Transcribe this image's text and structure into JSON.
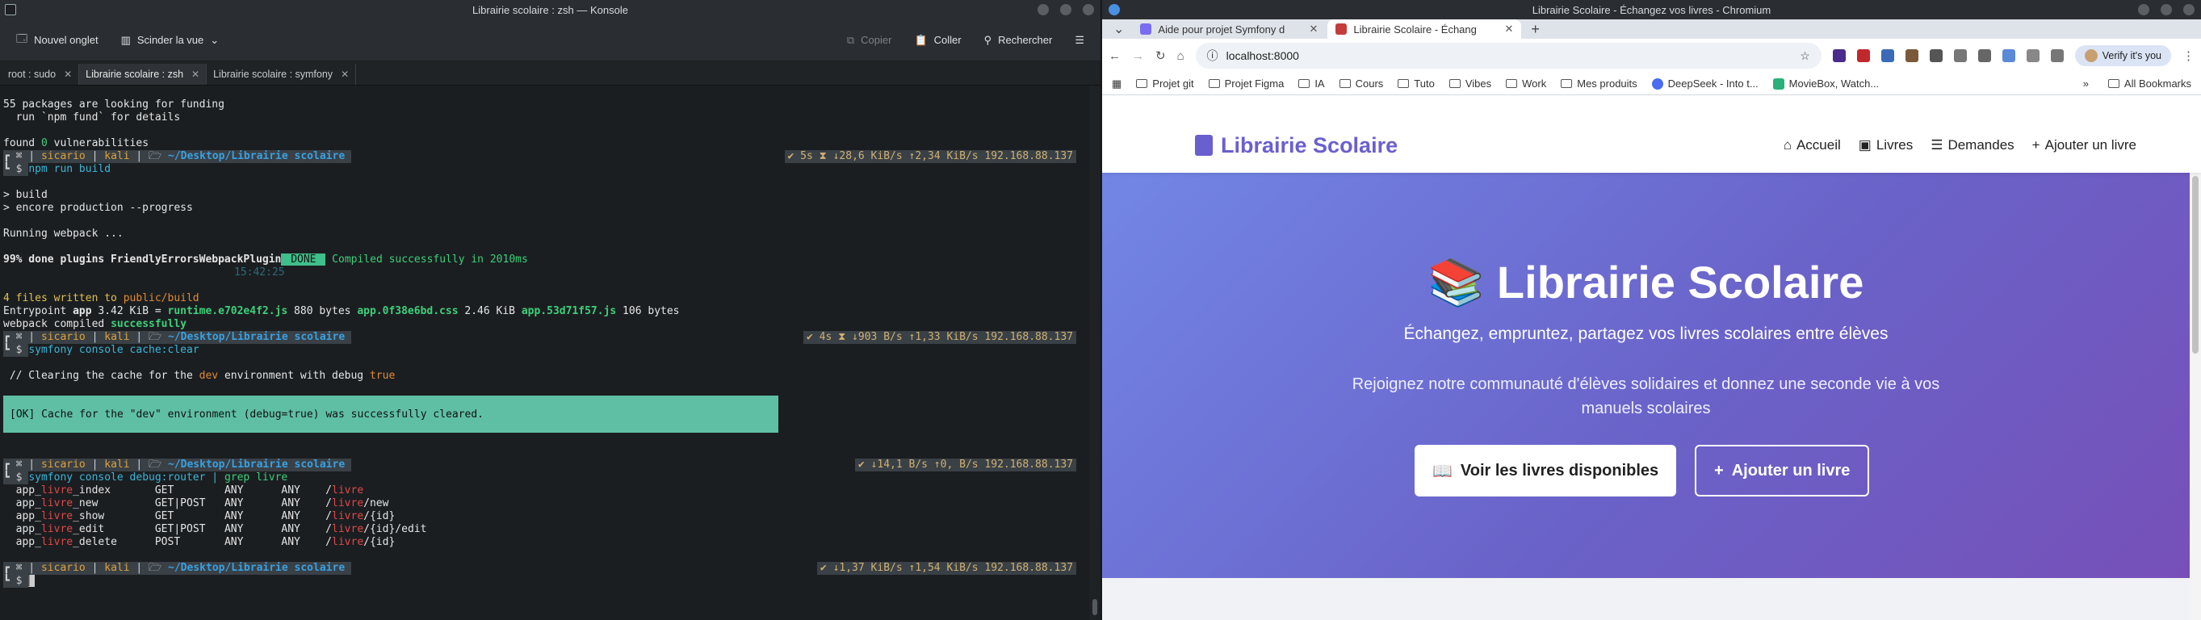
{
  "konsole": {
    "title": "Librairie scolaire : zsh — Konsole",
    "toolbar": {
      "new_tab": "Nouvel onglet",
      "split": "Scinder la vue",
      "copy": "Copier",
      "paste": "Coller",
      "search": "Rechercher"
    },
    "tabs": [
      {
        "label": "root : sudo"
      },
      {
        "label": "Librairie scolaire : zsh"
      },
      {
        "label": "Librairie scolaire : symfony"
      }
    ],
    "lines": {
      "l1": "55 packages are looking for funding",
      "l2": "  run `npm fund` for details",
      "l3a": "found ",
      "l3b": "0",
      "l3c": " vulnerabilities",
      "p_user": "sicario",
      "p_host": "kali",
      "p_path": "~/Desktop/Librairie scolaire",
      "s1": "✔ 5s ⧗ ↓28,6 KiB/s ↑2,34 KiB/s 192.168.88.137",
      "c1": "npm run build",
      "l4": "> build",
      "l5": "> encore production --progress",
      "l6": "Running webpack ...",
      "l7a": "99% done plugins FriendlyErrorsWebpackPlugin",
      "l7b": " DONE ",
      "l7c": " Compiled successfully in 2010ms",
      "l8": "15:42:25",
      "l9a": "4 files written to ",
      "l9b": "public/build",
      "l10a": "Entrypoint ",
      "l10b": "app",
      "l10c": " 3.42 KiB = ",
      "l10d": "runtime.e702e4f2.js",
      "l10e": " 880 bytes ",
      "l10f": "app.0f38e6bd.css",
      "l10g": " 2.46 KiB ",
      "l10h": "app.53d71f57.js",
      "l10i": " 106 bytes",
      "l11a": "webpack compiled ",
      "l11b": "successfully",
      "s2": "✔ 4s ⧗ ↓903 B/s ↑1,33 KiB/s 192.168.88.137",
      "c2": "symfony console cache:clear",
      "l12a": " // Clearing the cache for the ",
      "l12b": "dev",
      "l12c": " environment with debug ",
      "l12d": "true",
      "ok": "[OK] Cache for the \"dev\" environment (debug=true) was successfully cleared.",
      "s3": "✔ ↓14,1 B/s ↑0, B/s 192.168.88.137",
      "c3a": "symfony console debug:router | ",
      "c3b": "grep livre",
      "routes": [
        {
          "a": "app_",
          "b": "livre",
          "c": "_index       GET        ANY      ANY    /",
          "d": "livre",
          "e": ""
        },
        {
          "a": "app_",
          "b": "livre",
          "c": "_new         GET|POST   ANY      ANY    /",
          "d": "livre",
          "e": "/new"
        },
        {
          "a": "app_",
          "b": "livre",
          "c": "_show        GET        ANY      ANY    /",
          "d": "livre",
          "e": "/{id}"
        },
        {
          "a": "app_",
          "b": "livre",
          "c": "_edit        GET|POST   ANY      ANY    /",
          "d": "livre",
          "e": "/{id}/edit"
        },
        {
          "a": "app_",
          "b": "livre",
          "c": "_delete      POST       ANY      ANY    /",
          "d": "livre",
          "e": "/{id}"
        }
      ],
      "s4": "✔ ↓1,37 KiB/s ↑1,54 KiB/s 192.168.88.137"
    }
  },
  "browser": {
    "title": "Librairie Scolaire - Échangez vos livres - Chromium",
    "tabs": [
      {
        "label": "Aide pour projet Symfony d"
      },
      {
        "label": "Librairie Scolaire - Échang"
      }
    ],
    "url": "localhost:8000",
    "verify": "Verify it's you",
    "bookmarks": [
      "Projet git",
      "Projet Figma",
      "IA",
      "Cours",
      "Tuto",
      "Vibes",
      "Work",
      "Mes produits",
      "DeepSeek - Into t...",
      "MovieBox, Watch..."
    ],
    "all_bookmarks": "All Bookmarks",
    "site": {
      "brand": "Librairie Scolaire",
      "nav": [
        "Accueil",
        "Livres",
        "Demandes",
        "Ajouter un livre"
      ],
      "hero_title": "📚 Librairie Scolaire",
      "hero_sub": "Échangez, empruntez, partagez vos livres scolaires entre élèves",
      "hero_para": "Rejoignez notre communauté d'élèves solidaires et donnez une seconde vie à vos manuels scolaires",
      "btn_primary": "Voir les livres disponibles",
      "btn_secondary": "Ajouter un livre"
    }
  }
}
